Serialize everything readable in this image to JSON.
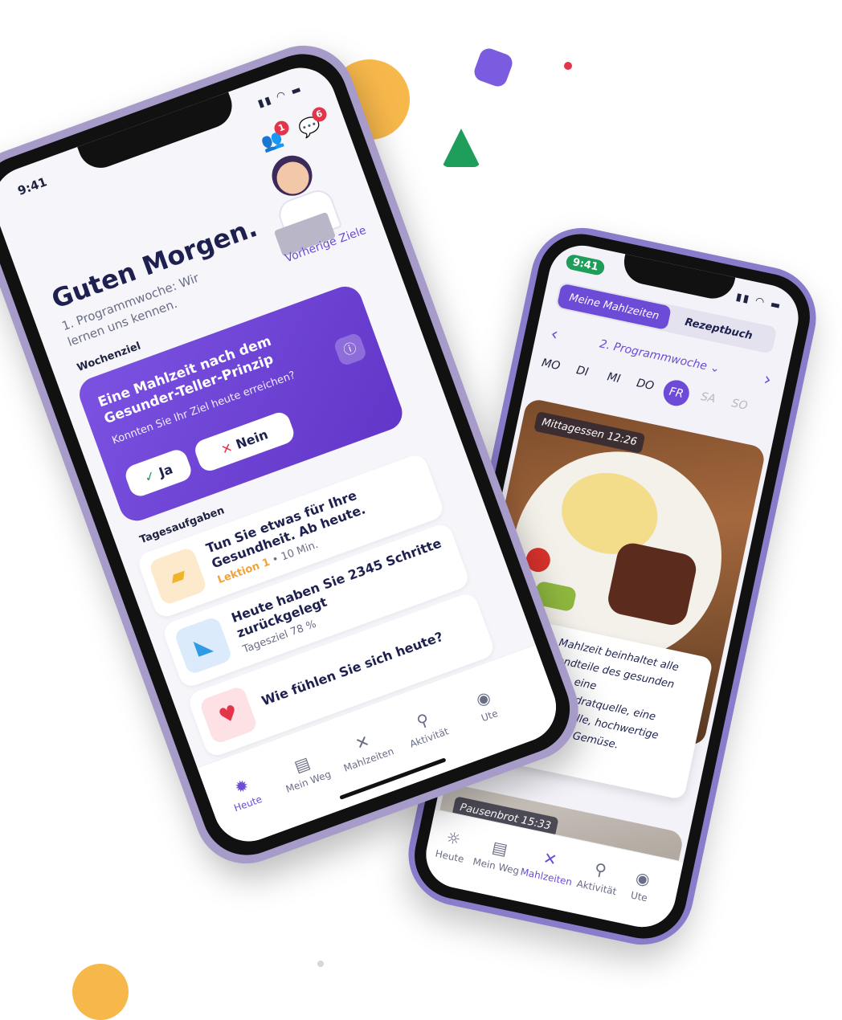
{
  "colors": {
    "accent": "#6c4bd6",
    "badge": "#e3344a",
    "yellow": "#f7b84b",
    "green": "#1f9d5b",
    "purple_blob": "#7b5be0"
  },
  "phone1": {
    "status": {
      "time": "9:41"
    },
    "header_badges": {
      "people_count": "1",
      "chat_count": "6"
    },
    "greeting": "Guten Morgen.",
    "program_week": "1. Programmwoche: Wir lernen uns kennen.",
    "previous_goals_link": "Vorherige Ziele",
    "weekly_goal_label": "Wochenziel",
    "goal_card": {
      "title": "Eine Mahlzeit nach dem Gesunder-Teller-Prinzip",
      "question": "Konnten Sie Ihr Ziel heute erreichen?",
      "yes_label": "Ja",
      "no_label": "Nein"
    },
    "daily_tasks_label": "Tagesaufgaben",
    "tasks": [
      {
        "title": "Tun Sie etwas für Ihre Gesundheit. Ab heute.",
        "sub_accent": "Lektion 1",
        "sub": "• 10 Min."
      },
      {
        "title": "Heute haben Sie 2345 Schritte zurückgelegt",
        "sub": "Tagesziel 78 %"
      },
      {
        "title": "Wie fühlen Sie sich heute?"
      }
    ],
    "tabs": [
      {
        "label": "Heute",
        "icon": "sun-icon"
      },
      {
        "label": "Mein Weg",
        "icon": "notebook-icon"
      },
      {
        "label": "Mahlzeiten",
        "icon": "cutlery-icon"
      },
      {
        "label": "Aktivität",
        "icon": "walking-icon"
      },
      {
        "label": "Ute",
        "icon": "user-icon"
      }
    ]
  },
  "phone2": {
    "status": {
      "time": "9:41"
    },
    "segments": {
      "active": "Meine Mahlzeiten",
      "inactive": "Rezeptbuch"
    },
    "week_selector": "2. Programmwoche",
    "days": [
      "MO",
      "DI",
      "MI",
      "DO",
      "FR",
      "SA",
      "SO"
    ],
    "selected_day": "FR",
    "meals": [
      {
        "tag": "Mittagessen 12:26"
      },
      {
        "tag": "Pausenbrot 15:33"
      }
    ],
    "chat_message": "Die Mahlzeit beinhaltet alle Bestandteile des gesunden Tellers - eine Kohlenhydratquelle, eine Eiweißquelle, hochwertige Fette und Gemüse.",
    "tabs": [
      {
        "label": "Heute",
        "icon": "sun-icon"
      },
      {
        "label": "Mein Weg",
        "icon": "notebook-icon"
      },
      {
        "label": "Mahlzeiten",
        "icon": "cutlery-icon"
      },
      {
        "label": "Aktivität",
        "icon": "walking-icon"
      },
      {
        "label": "Ute",
        "icon": "user-icon"
      }
    ]
  }
}
